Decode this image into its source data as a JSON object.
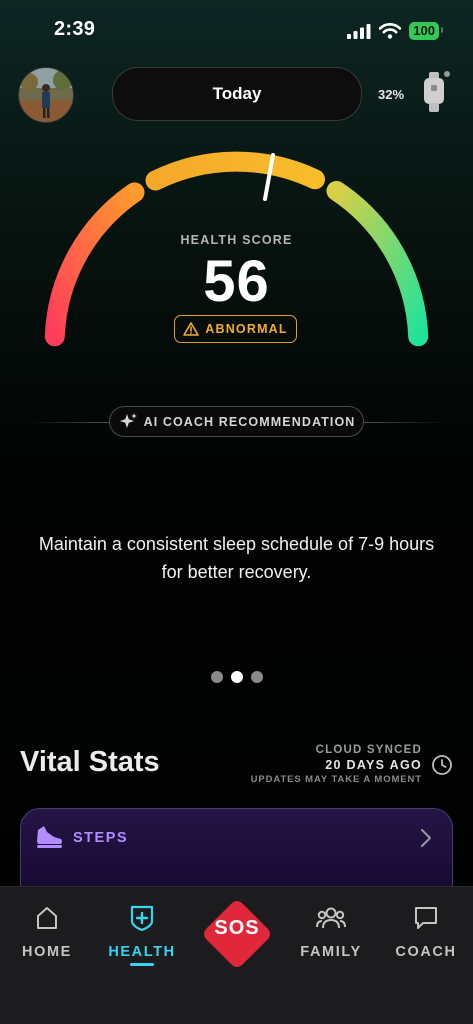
{
  "status_bar": {
    "time": "2:39",
    "battery": "100"
  },
  "header": {
    "date_selector": "Today",
    "device_battery": "32%"
  },
  "health": {
    "label": "HEALTH SCORE",
    "score": "56",
    "status": "ABNORMAL"
  },
  "coach": {
    "chip_label": "AI COACH RECOMMENDATION",
    "recommendation": "Maintain a consistent sleep schedule of 7-9 hours for better recovery.",
    "active_page": 2,
    "page_count": 3
  },
  "vital_stats": {
    "title": "Vital Stats",
    "sync_label": "CLOUD SYNCED",
    "sync_time": "20 DAYS AGO",
    "sync_note": "UPDATES MAY TAKE A MOMENT",
    "cards": [
      {
        "label": "STEPS",
        "icon": "sneaker-icon"
      }
    ]
  },
  "tabs": [
    {
      "label": "HOME",
      "icon": "home-icon"
    },
    {
      "label": "HEALTH",
      "icon": "health-shield-icon",
      "active": true
    },
    {
      "label": "SOS",
      "icon": "sos-icon"
    },
    {
      "label": "FAMILY",
      "icon": "family-icon"
    },
    {
      "label": "COACH",
      "icon": "chat-icon"
    }
  ],
  "colors": {
    "accent": "#36d4ee",
    "warning": "#f2ad2a",
    "sos": "#e0283a",
    "steps": "#b38cff",
    "gauge_low": "#ff3d5a",
    "gauge_mid": "#f6b024",
    "gauge_high": "#22e29a"
  }
}
